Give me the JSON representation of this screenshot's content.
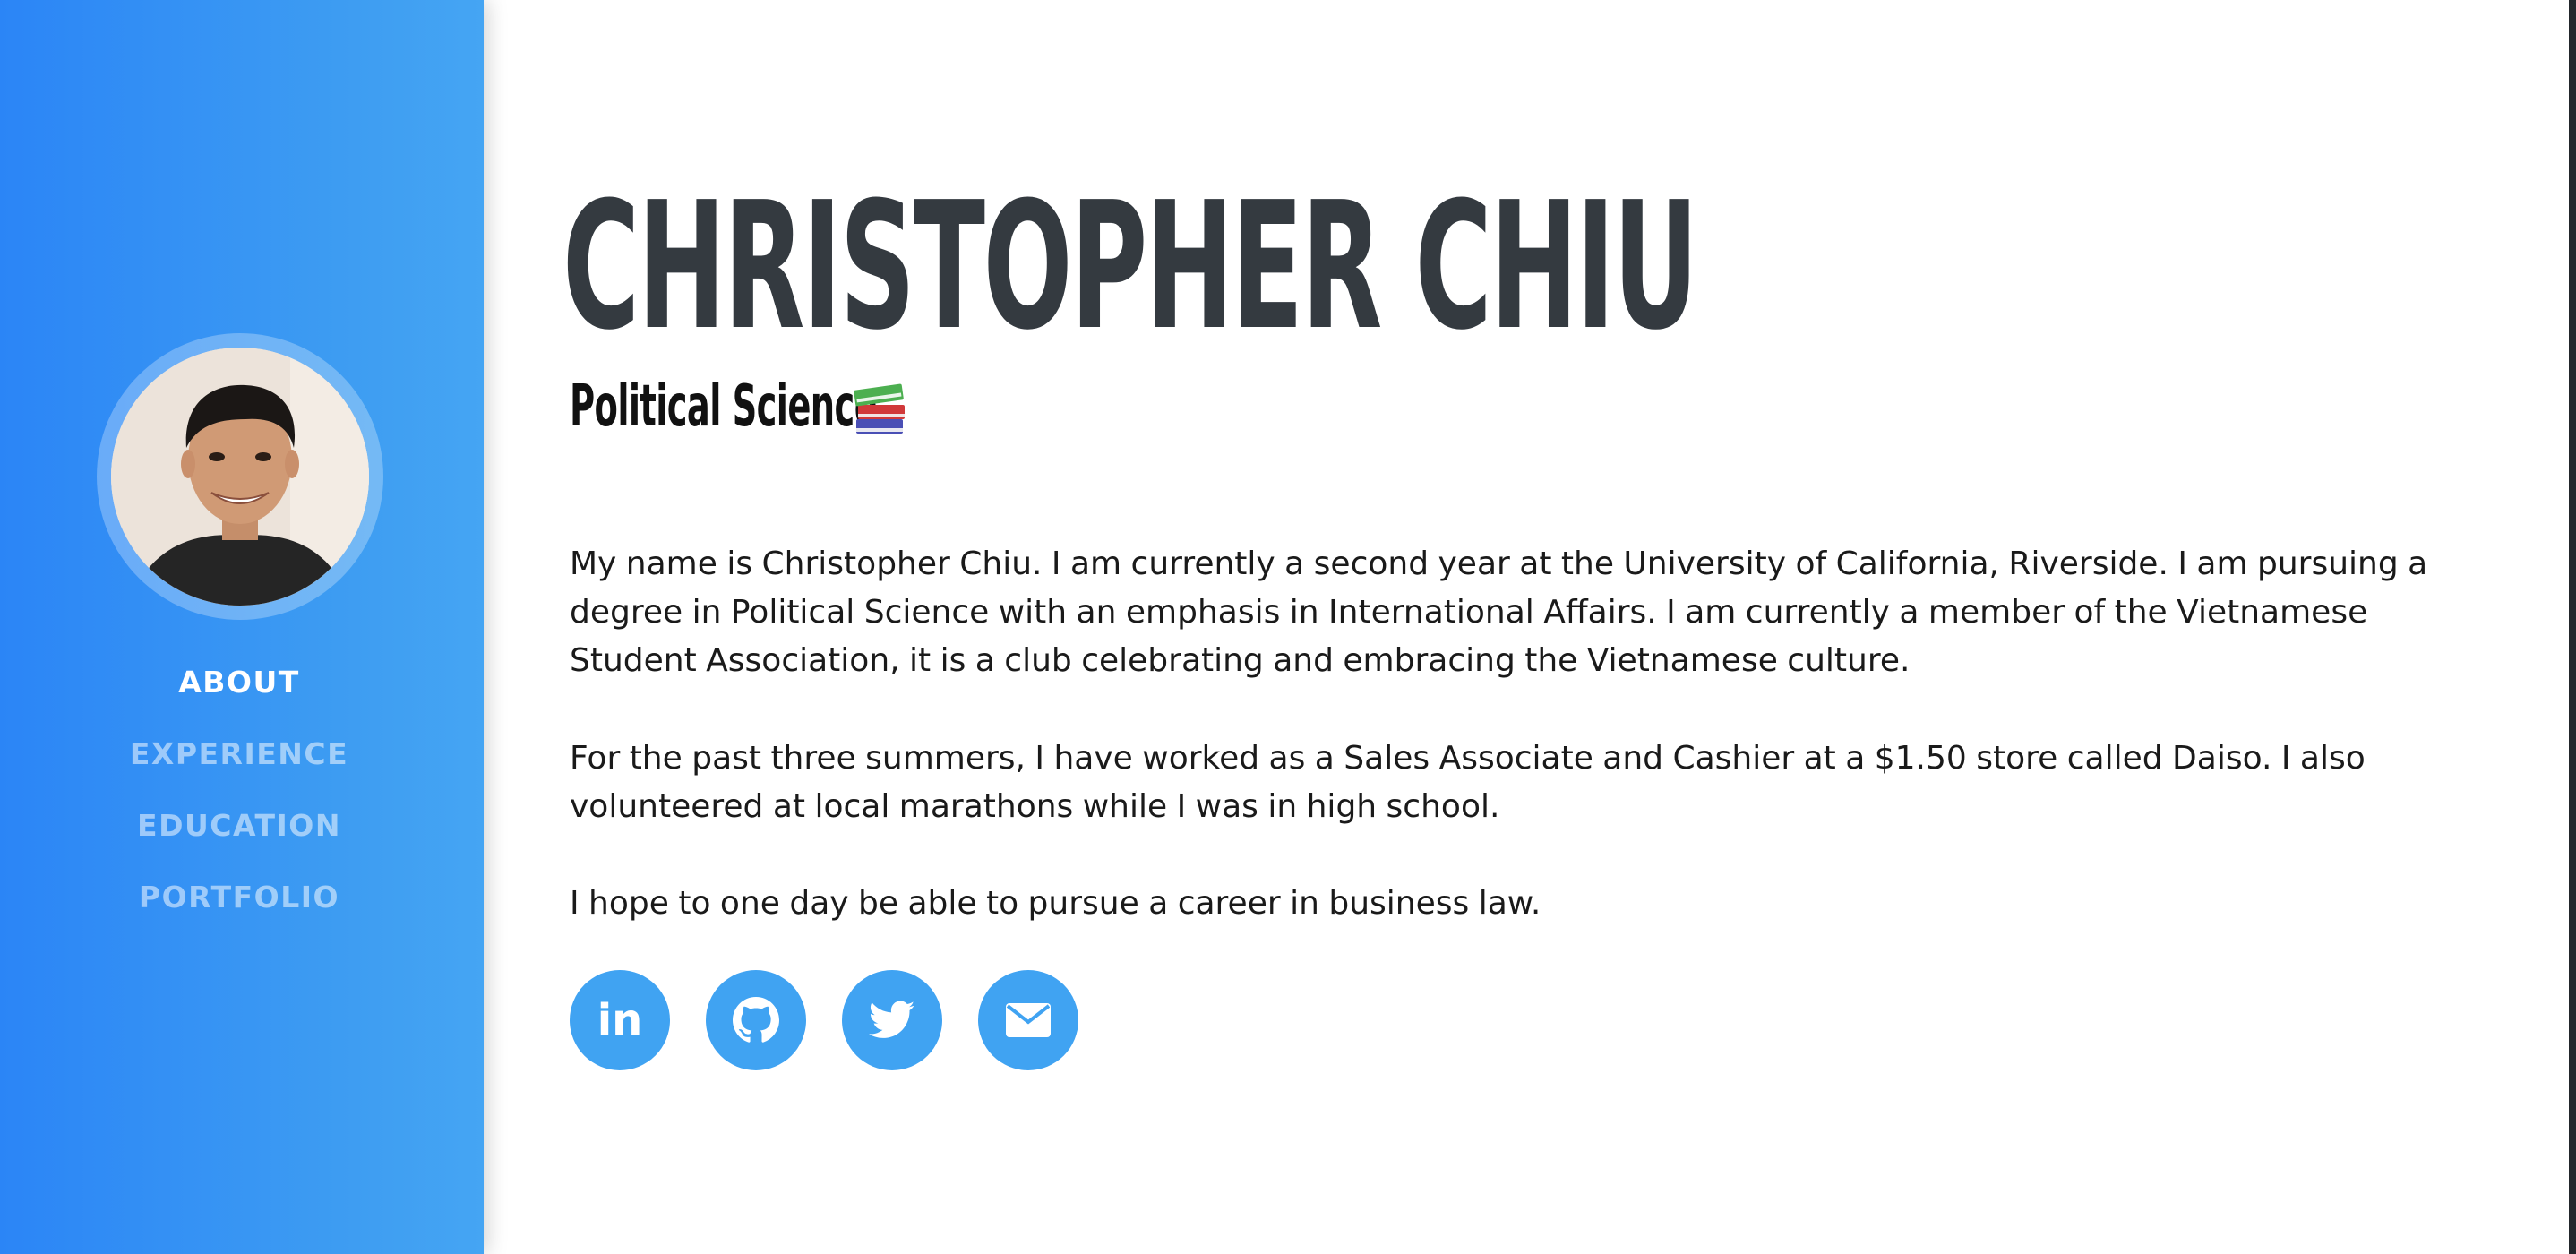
{
  "profile": {
    "name": "CHRISTOPHER CHIU",
    "subtitle": "Political Science",
    "subtitle_icon": "books-icon"
  },
  "nav": {
    "items": [
      {
        "label": "ABOUT",
        "active": true
      },
      {
        "label": "EXPERIENCE",
        "active": false
      },
      {
        "label": "EDUCATION",
        "active": false
      },
      {
        "label": "PORTFOLIO",
        "active": false
      }
    ]
  },
  "about": {
    "paragraphs": [
      "My name is Christopher Chiu. I am currently a second year at the University of California, Riverside. I am pursuing a degree in Political Science with an emphasis in International Affairs. I am currently a member of the Vietnamese Student Association, it is a club celebrating and embracing the Vietnamese culture.",
      "For the past three summers, I have worked as a Sales Associate and Cashier at a $1.50 store called Daiso. I also volunteered at local marathons while I was in high school.",
      "I hope to one day be able to pursue a career in business law."
    ]
  },
  "social": {
    "linkedin_text": "in",
    "icons": [
      "linkedin-icon",
      "github-icon",
      "twitter-icon",
      "email-icon"
    ]
  },
  "colors": {
    "sidebar_start": "#2b85f6",
    "sidebar_end": "#45a5f3",
    "social_button": "#40a3f2",
    "heading": "#343a40"
  }
}
